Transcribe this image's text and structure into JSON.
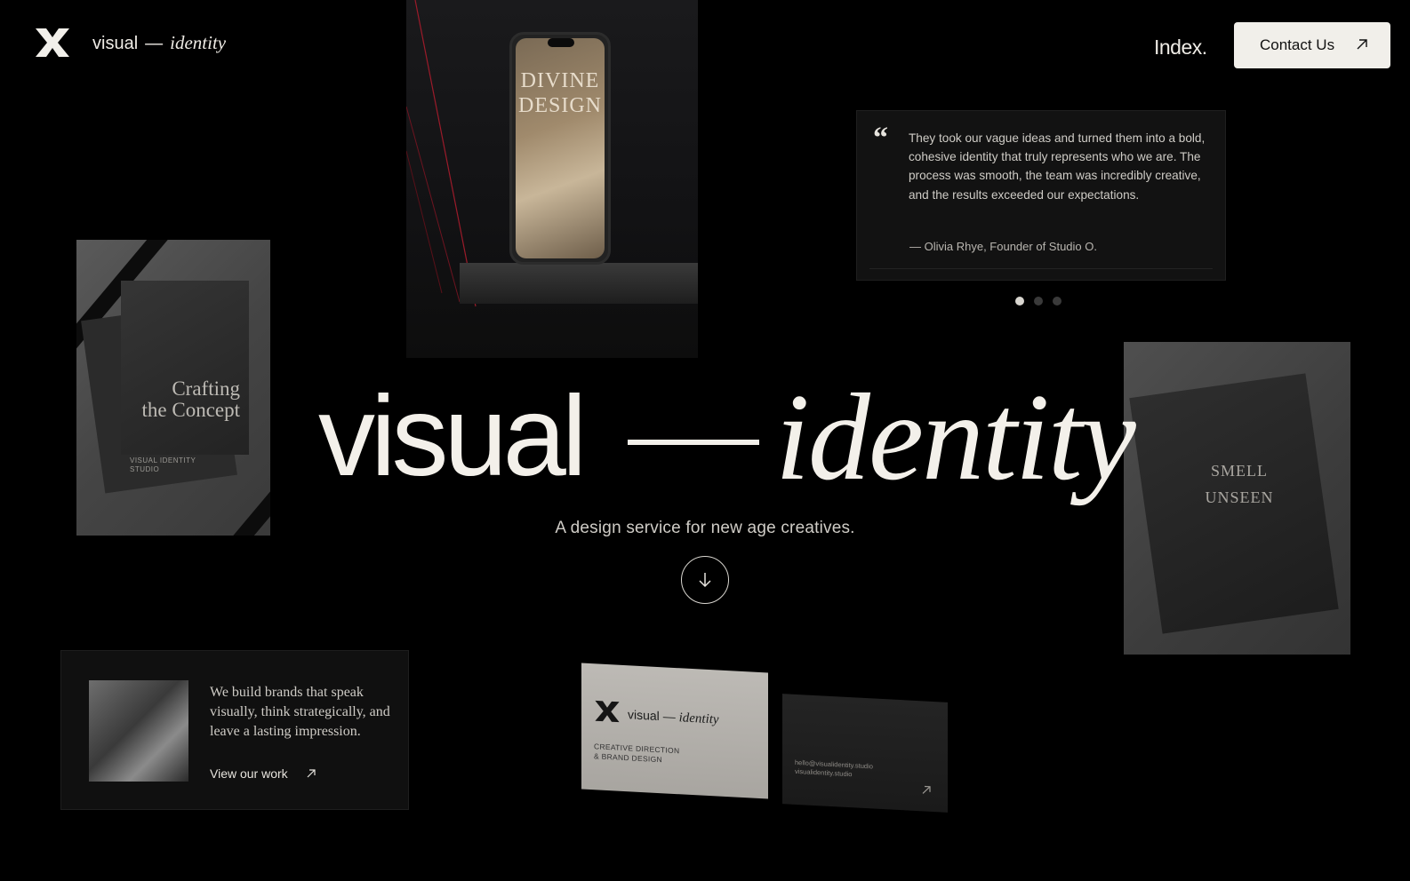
{
  "header": {
    "brand_regular": "visual",
    "brand_dash": "—",
    "brand_italic": "identity",
    "nav_index": "Index.",
    "contact_label": "Contact Us"
  },
  "phone_mockup": {
    "line1": "DIVINE",
    "line2": "DESIGN"
  },
  "book_mockup": {
    "title_line1": "Crafting",
    "title_line2": "the Concept",
    "foot_line1": "VISUAL IDENTITY",
    "foot_line2": "STUDIO"
  },
  "testimonial": {
    "quote_mark": "“",
    "text": "They took our vague ideas and turned them into a bold, cohesive identity that truly represents who we are. The process was smooth, the team was incredibly creative, and the results exceeded our expectations.",
    "author": "—  Olivia Rhye, Founder of Studio O.",
    "active_slide": 1,
    "slide_count": 3
  },
  "bag_mockup": {
    "line1": "SMELL",
    "line2": "UNSEEN"
  },
  "hero": {
    "title_regular": "visual",
    "title_italic": "identity",
    "subtitle": "A design service for new age creatives."
  },
  "about_card": {
    "text": "We build brands that speak visually, think strategically, and leave a lasting impression.",
    "link_label": "View our work"
  },
  "business_card": {
    "brand_regular": "visual",
    "brand_dash": "—",
    "brand_italic": "identity",
    "sub_line1": "CREATIVE DIRECTION",
    "sub_line2": "& BRAND DESIGN",
    "email": "hello@visualidentity.studio",
    "site": "visualidentity.studio"
  },
  "colors": {
    "background": "#000000",
    "text": "#f3f0ea",
    "button_bg": "#f1efea",
    "card_bg": "#121212"
  },
  "icons": {
    "logo": "x-mark-logo",
    "contact": "arrow-up-right-icon",
    "scroll": "arrow-down-icon",
    "link": "arrow-up-right-icon"
  }
}
